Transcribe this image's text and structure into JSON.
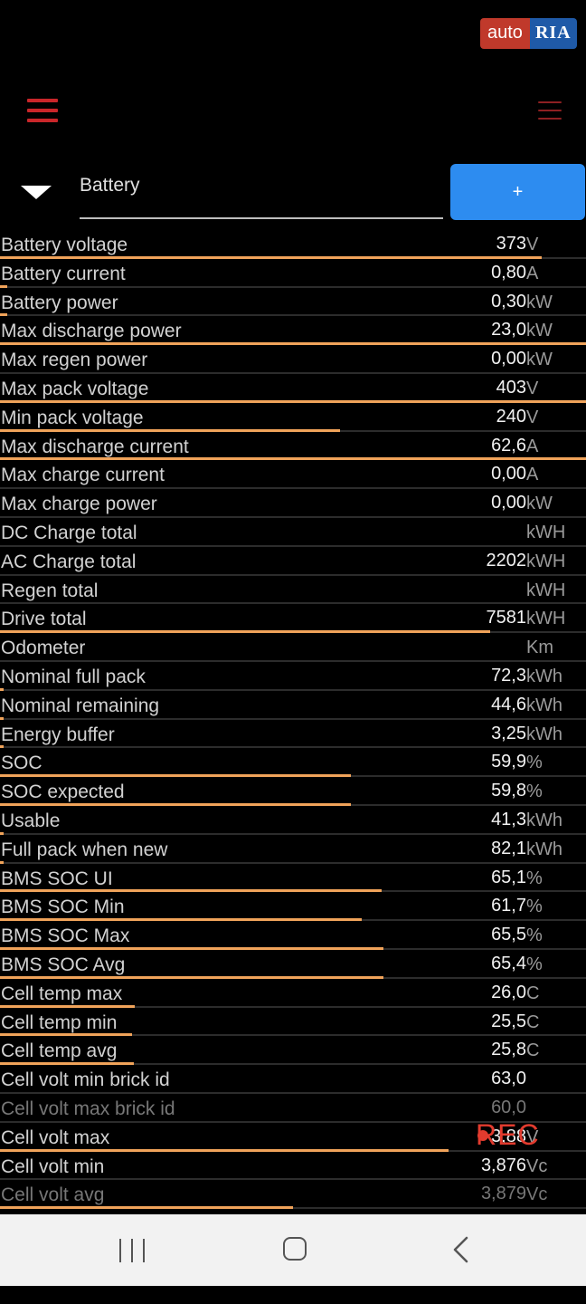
{
  "watermark": {
    "part1": "auto",
    "part2": "RIA"
  },
  "selector": {
    "label": "Battery"
  },
  "add_button": {
    "label": "+"
  },
  "rows": [
    {
      "label": "Battery voltage",
      "value": "373",
      "unit": "V",
      "bar": 0.924
    },
    {
      "label": "Battery current",
      "value": "0,80",
      "unit": "A",
      "bar": 0.012
    },
    {
      "label": "Battery power",
      "value": "0,30",
      "unit": "kW",
      "bar": 0.012
    },
    {
      "label": "Max discharge power",
      "value": "23,0",
      "unit": "kW",
      "bar": 1.0
    },
    {
      "label": "Max regen power",
      "value": "0,00",
      "unit": "kW",
      "bar": 0.0
    },
    {
      "label": "Max pack voltage",
      "value": "403",
      "unit": "V",
      "bar": 1.0
    },
    {
      "label": "Min pack voltage",
      "value": "240",
      "unit": "V",
      "bar": 0.58
    },
    {
      "label": "Max discharge current",
      "value": "62,6",
      "unit": "A",
      "bar": 1.0
    },
    {
      "label": "Max charge current",
      "value": "0,00",
      "unit": "A",
      "bar": 0.0
    },
    {
      "label": "Max charge power",
      "value": "0,00",
      "unit": "kW",
      "bar": 0.0
    },
    {
      "label": "DC Charge total",
      "value": "",
      "unit": "kWH",
      "bar": 0.0
    },
    {
      "label": "AC Charge total",
      "value": "2202",
      "unit": "kWH",
      "bar": 0.0
    },
    {
      "label": "Regen total",
      "value": "",
      "unit": "kWH",
      "bar": 0.0
    },
    {
      "label": "Drive total",
      "value": "7581",
      "unit": "kWH",
      "bar": 0.836
    },
    {
      "label": "Odometer",
      "value": "",
      "unit": "Km",
      "bar": 0.0
    },
    {
      "label": "Nominal full pack",
      "value": "72,3",
      "unit": "kWh",
      "bar": 0.006
    },
    {
      "label": "Nominal remaining",
      "value": "44,6",
      "unit": "kWh",
      "bar": 0.006
    },
    {
      "label": "Energy buffer",
      "value": "3,25",
      "unit": "kWh",
      "bar": 0.006
    },
    {
      "label": "SOC",
      "value": "59,9",
      "unit": "%",
      "bar": 0.599
    },
    {
      "label": "SOC expected",
      "value": "59,8",
      "unit": "%",
      "bar": 0.598
    },
    {
      "label": "Usable",
      "value": "41,3",
      "unit": "kWh",
      "bar": 0.006
    },
    {
      "label": "Full pack when new",
      "value": "82,1",
      "unit": "kWh",
      "bar": 0.006
    },
    {
      "label": "BMS SOC UI",
      "value": "65,1",
      "unit": "%",
      "bar": 0.651
    },
    {
      "label": "BMS SOC Min",
      "value": "61,7",
      "unit": "%",
      "bar": 0.617
    },
    {
      "label": "BMS SOC Max",
      "value": "65,5",
      "unit": "%",
      "bar": 0.655
    },
    {
      "label": "BMS SOC Avg",
      "value": "65,4",
      "unit": "%",
      "bar": 0.654
    },
    {
      "label": "Cell temp max",
      "value": "26,0",
      "unit": "C",
      "bar": 0.23
    },
    {
      "label": "Cell temp min",
      "value": "25,5",
      "unit": "C",
      "bar": 0.225
    },
    {
      "label": "Cell temp avg",
      "value": "25,8",
      "unit": "C",
      "bar": 0.228
    },
    {
      "label": "Cell volt min brick id",
      "value": "63,0",
      "unit": "",
      "bar": 0.0
    },
    {
      "label": "Cell volt max brick id",
      "value": "60,0",
      "unit": "",
      "bar": 0.0,
      "dim": true
    },
    {
      "label": "Cell volt max",
      "value": "3,88",
      "unit": "V",
      "bar": 0.765
    },
    {
      "label": "Cell volt min",
      "value": "3,876",
      "unit": "Vc",
      "bar": 0.0
    },
    {
      "label": "Cell volt avg",
      "value": "3,879",
      "unit": "Vc",
      "bar": 0.5,
      "dim": true
    }
  ],
  "overlay": {
    "rec": "REC"
  },
  "colors": {
    "bar": "#f0a35a",
    "menu": "#c9262a",
    "button": "#2d8cf0"
  },
  "icons": [
    "menu-icon",
    "overflow-menu-icon",
    "dropdown-arrow-icon",
    "recents-icon",
    "home-icon",
    "back-icon"
  ]
}
